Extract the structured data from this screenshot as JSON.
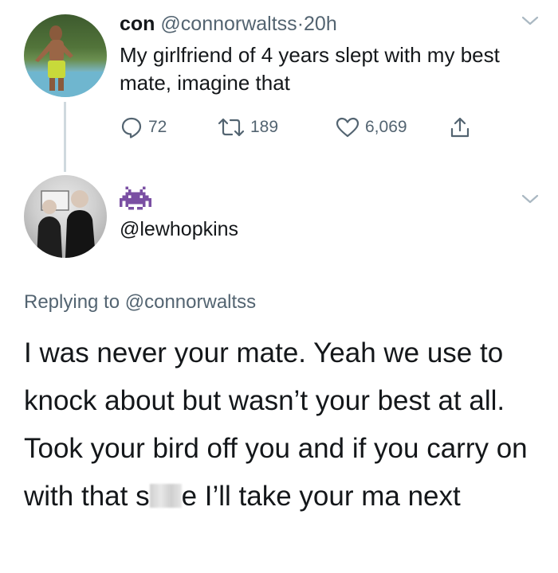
{
  "tweet": {
    "display_name": "con",
    "handle": "@connorwaltss",
    "separator": "·",
    "time": "20h",
    "text": "My girlfriend of 4 years slept with my best mate, imagine that",
    "replies": "72",
    "retweets": "189",
    "likes": "6,069"
  },
  "reply": {
    "handle": "@lewhopkins",
    "replying_prefix": "Replying to",
    "replying_to": "@connorwaltss",
    "text_part1": "I was never your mate. Yeah we use to knock about but wasn’t your best at all. Took your bird off you and if you carry on with that s",
    "text_part2": "e I’ll take your ma next"
  },
  "icons": {
    "reply": "reply-icon",
    "retweet": "retweet-icon",
    "like": "heart-icon",
    "share": "share-icon",
    "more": "chevron-down-icon",
    "emoji": "space-invader-icon"
  }
}
